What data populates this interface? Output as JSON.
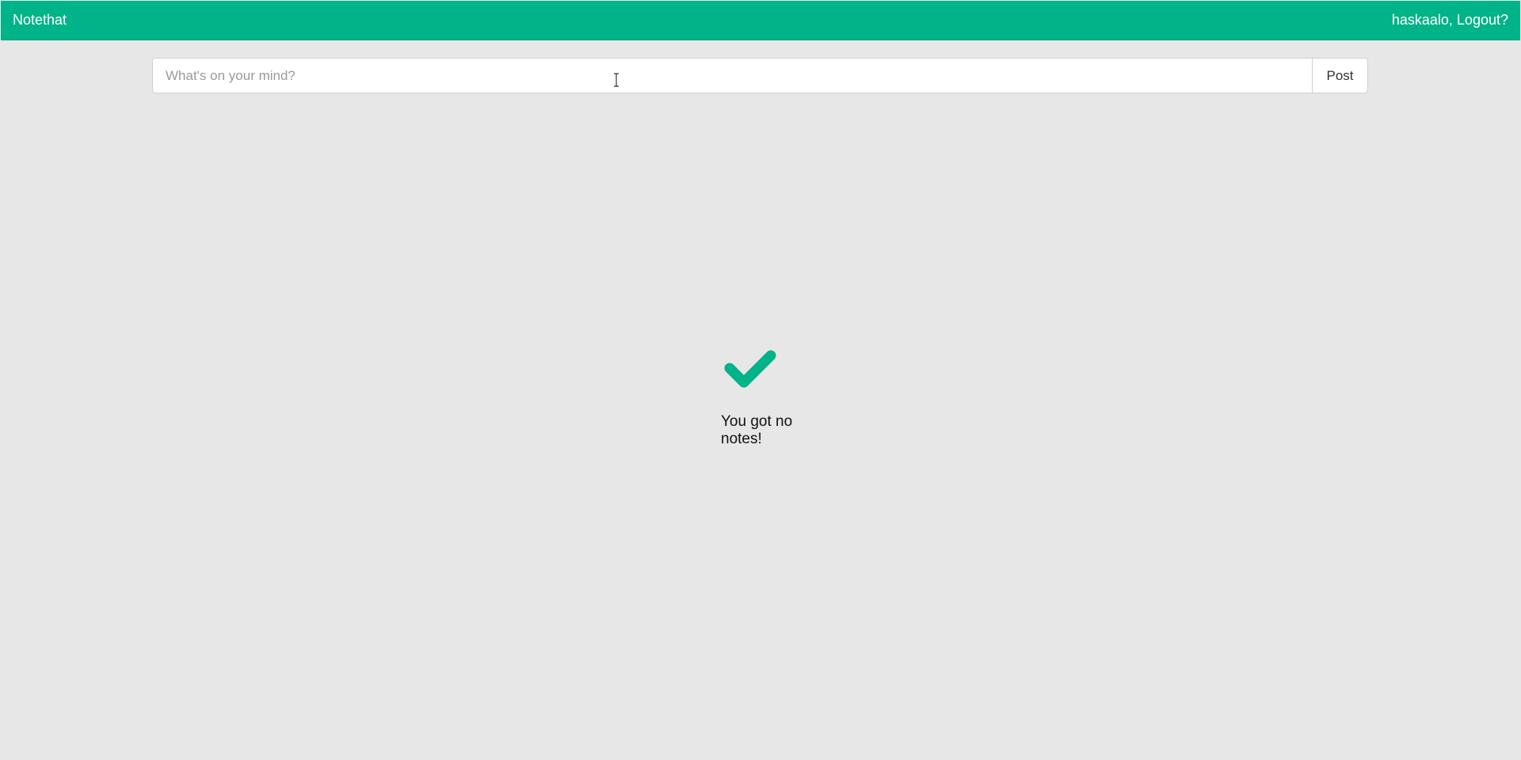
{
  "header": {
    "brand": "Notethat",
    "username": "haskaalo",
    "separator": ", ",
    "logout_label": "Logout?"
  },
  "composer": {
    "placeholder": "What's on your mind?",
    "value": "",
    "post_label": "Post"
  },
  "empty_state": {
    "icon": "checkmark-icon",
    "message": "You got no notes!"
  },
  "colors": {
    "accent": "#00b388",
    "background": "#e7e7e7",
    "text": "#111111"
  }
}
